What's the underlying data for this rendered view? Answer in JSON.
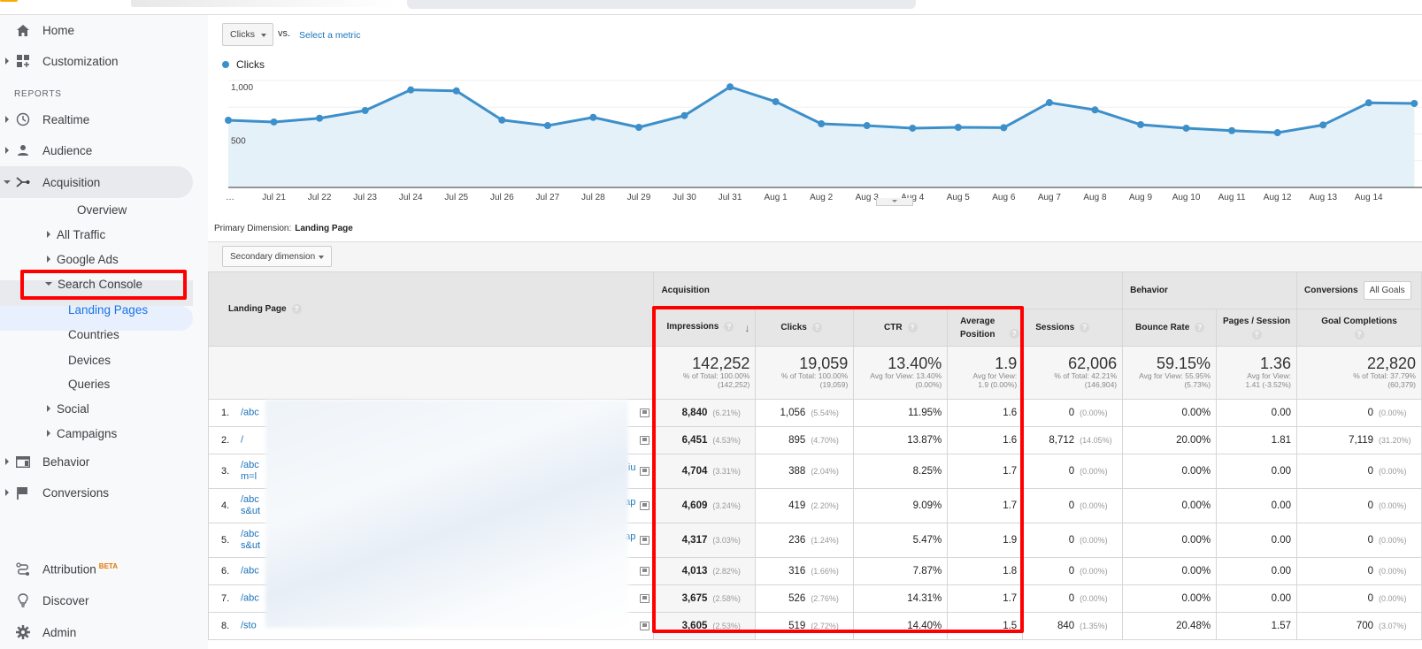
{
  "topbar": {},
  "sidebar": {
    "items": [
      {
        "label": "Home",
        "icon": "home-icon"
      },
      {
        "label": "Customization",
        "icon": "dashboard-icon"
      },
      {
        "label": "Realtime",
        "icon": "clock-icon"
      },
      {
        "label": "Audience",
        "icon": "person-icon"
      },
      {
        "label": "Acquisition",
        "icon": "acquisition-icon"
      },
      {
        "label": "Behavior",
        "icon": "behavior-icon"
      },
      {
        "label": "Conversions",
        "icon": "flag-icon"
      }
    ],
    "section_label": "REPORTS",
    "acquisition_sub": [
      "Overview",
      "All Traffic",
      "Google Ads",
      "Search Console",
      "Social",
      "Campaigns"
    ],
    "search_console_sub": [
      "Landing Pages",
      "Countries",
      "Devices",
      "Queries"
    ],
    "bottom": [
      {
        "label": "Attribution",
        "badge": "BETA",
        "icon": "attribution-icon"
      },
      {
        "label": "Discover",
        "icon": "lightbulb-icon"
      },
      {
        "label": "Admin",
        "icon": "gear-icon"
      }
    ]
  },
  "chart_controls": {
    "metric": "Clicks",
    "vs": "vs.",
    "select_metric": "Select a metric",
    "legend": "Clicks"
  },
  "chart_data": {
    "type": "area",
    "title": "",
    "series": [
      {
        "name": "Clicks",
        "color": "#3d8fca",
        "values": [
          628,
          612,
          647,
          719,
          912,
          903,
          630,
          578,
          655,
          562,
          672,
          940,
          802,
          595,
          578,
          554,
          562,
          559,
          793,
          725,
          587,
          554,
          531,
          512,
          584,
          791,
          785
        ]
      }
    ],
    "x": [
      "…",
      "Jul 21",
      "Jul 22",
      "Jul 23",
      "Jul 24",
      "Jul 25",
      "Jul 26",
      "Jul 27",
      "Jul 28",
      "Jul 29",
      "Jul 30",
      "Jul 31",
      "Aug 1",
      "Aug 2",
      "Aug 3",
      "Aug 4",
      "Aug 5",
      "Aug 6",
      "Aug 7",
      "Aug 8",
      "Aug 9",
      "Aug 10",
      "Aug 11",
      "Aug 12",
      "Aug 13",
      "Aug 14",
      ""
    ],
    "yticks": [
      "1,000",
      "500"
    ],
    "ytick_values": [
      1000,
      500
    ],
    "ylim": [
      0,
      1000
    ],
    "grid": true,
    "legend": "top-left"
  },
  "dimension": {
    "primary_label": "Primary Dimension:",
    "primary_value": "Landing Page",
    "secondary_label": "Secondary dimension"
  },
  "table": {
    "groups": {
      "acquisition": "Acquisition",
      "behavior": "Behavior",
      "conversions": "Conversions",
      "conversions_dropdown": "All Goals"
    },
    "landing_header": "Landing Page",
    "columns": [
      "Impressions",
      "Clicks",
      "CTR",
      "Average Position",
      "Sessions",
      "Bounce Rate",
      "Pages / Session",
      "Goal Completions"
    ],
    "totals": [
      {
        "value": "142,252",
        "sub1": "% of Total: 100.00%",
        "sub2": "(142,252)"
      },
      {
        "value": "19,059",
        "sub1": "% of Total: 100.00%",
        "sub2": "(19,059)"
      },
      {
        "value": "13.40%",
        "sub1": "Avg for View: 13.40%",
        "sub2": "(0.00%)"
      },
      {
        "value": "1.9",
        "sub1": "Avg for View:",
        "sub2": "1.9 (0.00%)"
      },
      {
        "value": "62,006",
        "sub1": "% of Total: 42.21%",
        "sub2": "(146,904)"
      },
      {
        "value": "59.15%",
        "sub1": "Avg for View: 55.95%",
        "sub2": "(5.73%)"
      },
      {
        "value": "1.36",
        "sub1": "Avg for View:",
        "sub2": "1.41 (-3.52%)"
      },
      {
        "value": "22,820",
        "sub1": "% of Total: 37.79%",
        "sub2": "(60,379)"
      }
    ],
    "rows": [
      {
        "n": "1.",
        "page": "/abc",
        "page2": "",
        "tail": "",
        "impr": "8,840",
        "impr_pct": "(6.21%)",
        "clicks": "1,056",
        "clicks_pct": "(5.54%)",
        "ctr": "11.95%",
        "pos": "1.6",
        "sess": "0",
        "sess_pct": "(0.00%)",
        "bounce": "0.00%",
        "pps": "0.00",
        "goal": "0",
        "goal_pct": "(0.00%)"
      },
      {
        "n": "2.",
        "page": "/",
        "page2": "",
        "tail": "",
        "impr": "6,451",
        "impr_pct": "(4.53%)",
        "clicks": "895",
        "clicks_pct": "(4.70%)",
        "ctr": "13.87%",
        "pos": "1.6",
        "sess": "8,712",
        "sess_pct": "(14.05%)",
        "bounce": "20.00%",
        "pps": "1.81",
        "goal": "7,119",
        "goal_pct": "(31.20%)"
      },
      {
        "n": "3.",
        "page": "/abc",
        "page2": "m=l",
        "tail": "iu",
        "impr": "4,704",
        "impr_pct": "(3.31%)",
        "clicks": "388",
        "clicks_pct": "(2.04%)",
        "ctr": "8.25%",
        "pos": "1.7",
        "sess": "0",
        "sess_pct": "(0.00%)",
        "bounce": "0.00%",
        "pps": "0.00",
        "goal": "0",
        "goal_pct": "(0.00%)"
      },
      {
        "n": "4.",
        "page": "/abc",
        "page2": "s&ut",
        "tail": "ap",
        "impr": "4,609",
        "impr_pct": "(3.24%)",
        "clicks": "419",
        "clicks_pct": "(2.20%)",
        "ctr": "9.09%",
        "pos": "1.7",
        "sess": "0",
        "sess_pct": "(0.00%)",
        "bounce": "0.00%",
        "pps": "0.00",
        "goal": "0",
        "goal_pct": "(0.00%)"
      },
      {
        "n": "5.",
        "page": "/abc",
        "page2": "s&ut",
        "tail": "ap",
        "impr": "4,317",
        "impr_pct": "(3.03%)",
        "clicks": "236",
        "clicks_pct": "(1.24%)",
        "ctr": "5.47%",
        "pos": "1.9",
        "sess": "0",
        "sess_pct": "(0.00%)",
        "bounce": "0.00%",
        "pps": "0.00",
        "goal": "0",
        "goal_pct": "(0.00%)"
      },
      {
        "n": "6.",
        "page": "/abc",
        "page2": "",
        "tail": "",
        "impr": "4,013",
        "impr_pct": "(2.82%)",
        "clicks": "316",
        "clicks_pct": "(1.66%)",
        "ctr": "7.87%",
        "pos": "1.8",
        "sess": "0",
        "sess_pct": "(0.00%)",
        "bounce": "0.00%",
        "pps": "0.00",
        "goal": "0",
        "goal_pct": "(0.00%)"
      },
      {
        "n": "7.",
        "page": "/abc",
        "page2": "",
        "tail": "",
        "impr": "3,675",
        "impr_pct": "(2.58%)",
        "clicks": "526",
        "clicks_pct": "(2.76%)",
        "ctr": "14.31%",
        "pos": "1.7",
        "sess": "0",
        "sess_pct": "(0.00%)",
        "bounce": "0.00%",
        "pps": "0.00",
        "goal": "0",
        "goal_pct": "(0.00%)"
      },
      {
        "n": "8.",
        "page": "/sto",
        "page2": "",
        "tail": "",
        "impr": "3,605",
        "impr_pct": "(2.53%)",
        "clicks": "519",
        "clicks_pct": "(2.72%)",
        "ctr": "14.40%",
        "pos": "1.5",
        "sess": "840",
        "sess_pct": "(1.35%)",
        "bounce": "20.48%",
        "pps": "1.57",
        "goal": "700",
        "goal_pct": "(3.07%)"
      }
    ]
  }
}
